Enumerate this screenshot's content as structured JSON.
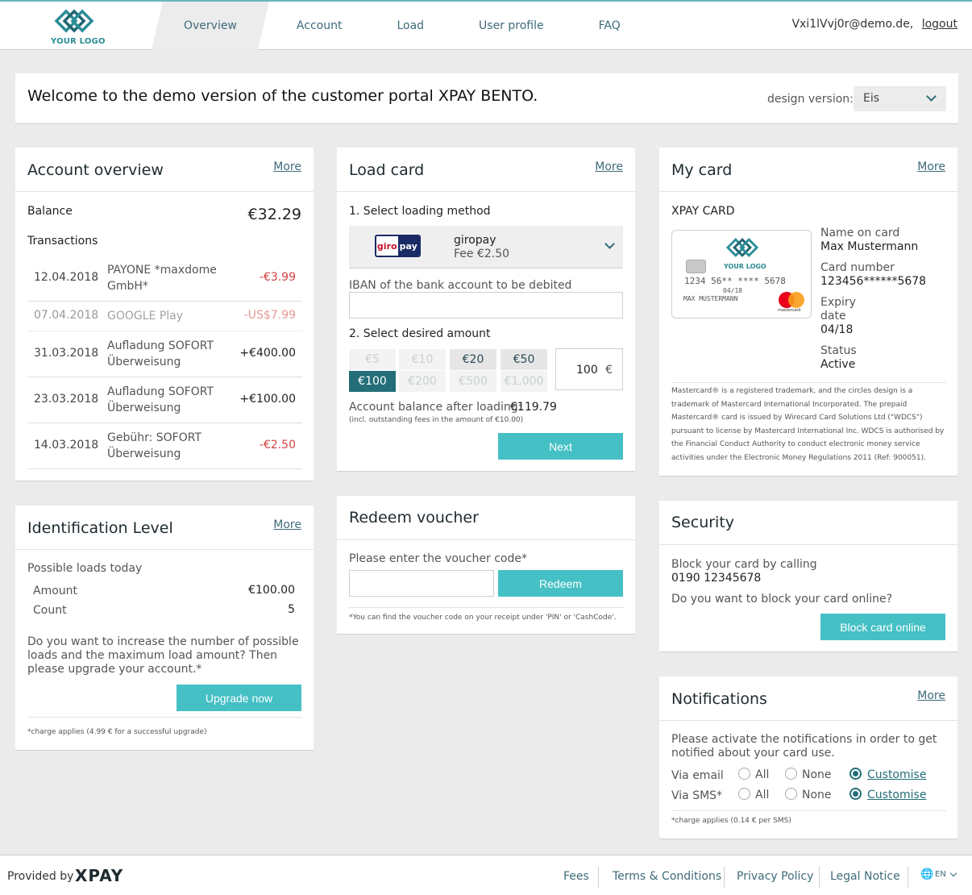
{
  "header": {
    "logo_text": "YOUR LOGO",
    "nav": [
      "Overview",
      "Account",
      "Load",
      "User profile",
      "FAQ"
    ],
    "user_email": "Vxi1lVvj0r@demo.de,",
    "logout_label": "logout"
  },
  "welcome": {
    "text": "Welcome to the demo version of the customer portal XPAY BENTO.",
    "design_label": "design version:",
    "design_value": "Eis"
  },
  "account_overview": {
    "title": "Account overview",
    "more": "More",
    "balance_label": "Balance",
    "balance_value": "€32.29",
    "transactions_label": "Transactions",
    "transactions": [
      {
        "date": "12.04.2018",
        "name": "PAYONE *maxdome GmbH*",
        "amount": "-€3.99"
      },
      {
        "date": "07.04.2018",
        "name": "GOOGLE Play",
        "amount": "-US$7.99"
      },
      {
        "date": "31.03.2018",
        "name": "Aufladung SOFORT Überweisung",
        "amount": "+€400.00"
      },
      {
        "date": "23.03.2018",
        "name": "Aufladung SOFORT Überweisung",
        "amount": "+€100.00"
      },
      {
        "date": "14.03.2018",
        "name": "Gebühr: SOFORT Überweisung",
        "amount": "-€2.50"
      }
    ]
  },
  "identification": {
    "title": "Identification Level",
    "more": "More",
    "possible_label": "Possible loads today",
    "amount_label": "Amount",
    "amount_value": "€100.00",
    "count_label": "Count",
    "count_value": "5",
    "text": "Do you want to increase the number of possible loads and the maximum load amount? Then please upgrade your account.*",
    "button": "Upgrade now",
    "note": "*charge applies (4.99 € for a successful upgrade)"
  },
  "load_card": {
    "title": "Load card",
    "more": "More",
    "step1": "1. Select loading method",
    "method_logo_a": "giro",
    "method_logo_b": "pay",
    "method_name": "giropay",
    "method_fee": "Fee €2.50",
    "iban_label": "IBAN of the bank account to be debited",
    "iban_value": "",
    "step2": "2. Select desired amount",
    "amounts": [
      "€5",
      "€10",
      "€20",
      "€50",
      "€100",
      "€200",
      "€500",
      "€1,000"
    ],
    "custom_amount": "100",
    "currency": "€",
    "balance_after_label": "Account balance after loading:",
    "balance_after_value": "€119.79",
    "fees_note": "(incl. outstanding fees in the amount of €10.00)",
    "next": "Next"
  },
  "voucher": {
    "title": "Redeem voucher",
    "label": "Please enter the voucher code*",
    "value": "",
    "button": "Redeem",
    "note": "*You can find the voucher code on your receipt under 'PIN' or 'CashCode'."
  },
  "my_card": {
    "title": "My card",
    "more": "More",
    "card_label": "XPAY CARD",
    "card_logo": "YOUR LOGO",
    "card_number_print": "1234 56** **** 5678",
    "card_expiry_print": "04/18",
    "card_name_print": "MAX MUSTERMANN",
    "mastercard_label": "mastercard",
    "name_label": "Name on card",
    "name_value": "Max Mustermann",
    "number_label": "Card number",
    "number_value": "123456******5678",
    "expiry_label": "Expiry date",
    "expiry_value": "04/18",
    "status_label": "Status",
    "status_value": "Active",
    "legal": "Mastercard® is a registered trademark, and the circles design is a trademark of Mastercard International Incorporated. The prepaid Mastercard® card is issued by Wirecard Card Solutions Ltd (\"WDCS\") pursuant to license by Mastercard International Inc. WDCS is authorised by the Financial Conduct Authority to conduct electronic money service activities under the Electronic Money Regulations 2011 (Ref: 900051)."
  },
  "security": {
    "title": "Security",
    "block_label": "Block your card by calling",
    "phone": "0190 12345678",
    "question": "Do you want to block your card online?",
    "button": "Block card online"
  },
  "notifications": {
    "title": "Notifications",
    "more": "More",
    "text": "Please activate the notifications in order to get notified about your card use.",
    "email_label": "Via email",
    "sms_label": "Via SMS*",
    "opt_all": "All",
    "opt_none": "None",
    "opt_custom": "Customise",
    "note": "*charge applies (0.14 € per SMS)"
  },
  "footer": {
    "provided_by": "Provided by",
    "brand": "XPAY",
    "links": [
      "Fees",
      "Terms & Conditions",
      "Privacy Policy",
      "Legal Notice"
    ],
    "lang": "EN"
  },
  "colors": {
    "accent": "#45c0c5",
    "selected": "#236e78",
    "negative": "#d33f3f"
  }
}
